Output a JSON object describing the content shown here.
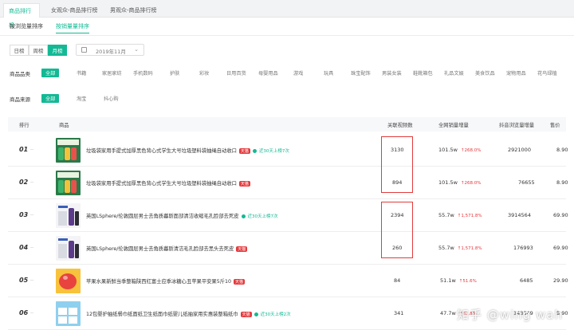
{
  "top_tabs": [
    "商品排行榜",
    "女观众-商品排行榜",
    "男观众-商品排行榜"
  ],
  "sub_tabs": [
    "按浏览量排序",
    "按销量量排序"
  ],
  "period": {
    "buttons": [
      "日榜",
      "周榜",
      "月榜"
    ],
    "active": "月榜",
    "date_value": "2019年11月"
  },
  "category": {
    "label": "商品品类",
    "items": [
      "全部",
      "书籍",
      "家居家纺",
      "手机数码",
      "护肤",
      "彩妆",
      "日用百货",
      "母婴用品",
      "游戏",
      "玩具",
      "珠宝配饰",
      "男装女装",
      "鞋靴箱包",
      "礼品文娱",
      "美食饮品",
      "宠物用品",
      "花鸟绿植"
    ]
  },
  "source": {
    "label": "商品来源",
    "items": [
      "全部",
      "淘宝",
      "抖心购"
    ]
  },
  "table": {
    "headers": [
      "排行",
      "商品",
      "关联视频数",
      "全网销量增量",
      "抖音浏览量增量",
      "售价"
    ],
    "rows": [
      {
        "rank": "01",
        "dash": "--",
        "title": "垃圾袋家用手提式加厚黑色背心式学生大号垃圾塑料袋抽绳自动收口",
        "tmall": "天猫",
        "tag": "近30天上榜7次",
        "videos": "3130",
        "sales": "101.5w",
        "sales_growth": "↑268.0%",
        "views": "2921000",
        "price": "8.90"
      },
      {
        "rank": "02",
        "dash": "--",
        "title": "垃圾袋家用手提式加厚黑色背心式学生大号垃圾塑料袋抽绳自动收口",
        "tmall": "天猫",
        "tag": "",
        "videos": "894",
        "sales": "101.5w",
        "sales_growth": "↑268.0%",
        "views": "76655",
        "price": "8.90"
      },
      {
        "rank": "03",
        "dash": "--",
        "title": "英国LSphere/伦敦圆层男士去角质暮斯面部清洁收缩毛孔脸部去死皮",
        "tmall": "",
        "tag": "近30天上榜7次",
        "videos": "2394",
        "sales": "55.7w",
        "sales_growth": "↑1,571.8%",
        "views": "3914564",
        "price": "69.90"
      },
      {
        "rank": "04",
        "dash": "--",
        "title": "英国LSphere/伦敦圆层男士去角质暮斯清洁毛孔脸部去黑头去死皮",
        "tmall": "天猫",
        "tag": "",
        "videos": "260",
        "sales": "55.7w",
        "sales_growth": "↑1,571.8%",
        "views": "176993",
        "price": "69.90"
      },
      {
        "rank": "05",
        "dash": "--",
        "title": "苹果水果新鲜当季整箱陕西红富士应季冰糖心丑苹果平安果5斤10",
        "tmall": "天猫",
        "tag": "",
        "videos": "84",
        "sales": "51.1w",
        "sales_growth": "↑51.6%",
        "views": "6485",
        "price": "29.90"
      },
      {
        "rank": "06",
        "dash": "--",
        "title": "12包婴护抽纸餐巾纸面纸卫生纸面巾纸婴儿纸抽家用实惠装整箱纸巾",
        "tmall": "天猫",
        "tag": "近30天上榜2次",
        "videos": "341",
        "sales": "47.7w",
        "sales_growth": "↑82.8%",
        "views": "143349",
        "price": "8.90"
      }
    ]
  },
  "watermark": "知乎 @wing wah",
  "colors": {
    "accent": "#13b994",
    "up": "#e4393c",
    "highlight_box": "#e23b3b"
  }
}
